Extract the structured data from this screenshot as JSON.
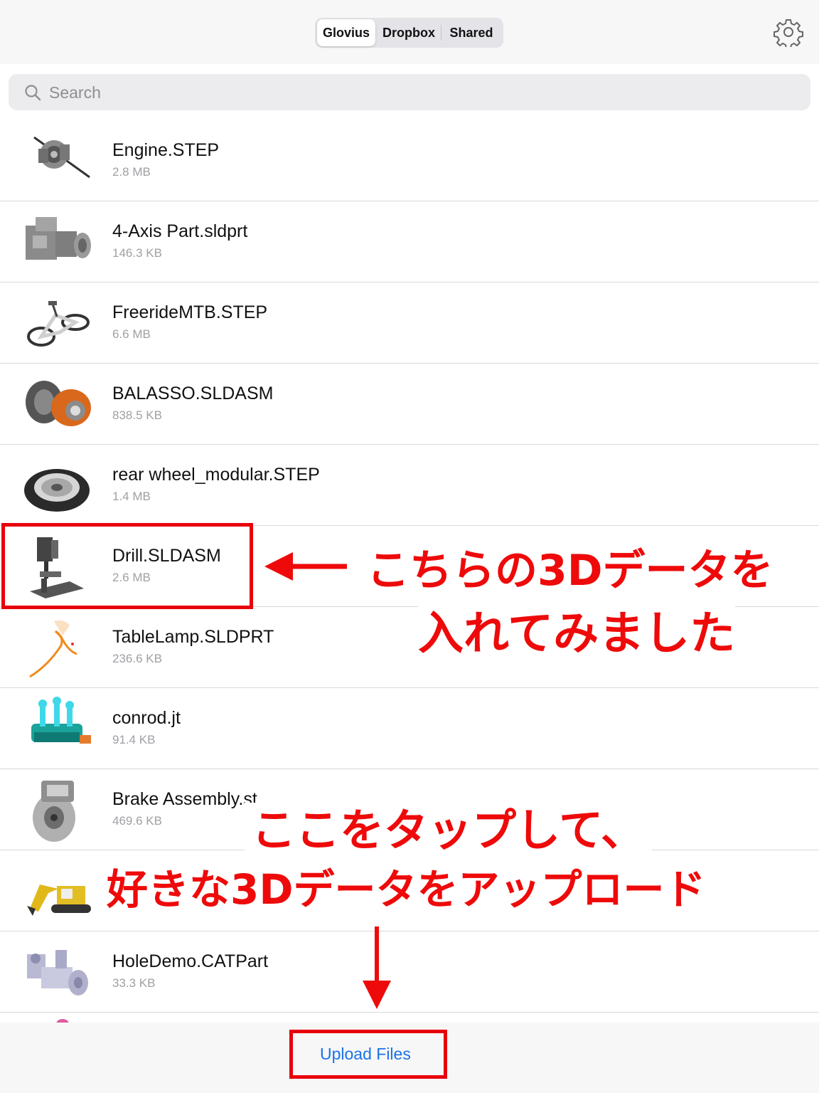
{
  "header": {
    "tabs": [
      {
        "label": "Glovius",
        "active": true
      },
      {
        "label": "Dropbox",
        "active": false
      },
      {
        "label": "Shared",
        "active": false
      }
    ],
    "settings_icon": "gear-icon"
  },
  "search": {
    "placeholder": "Search",
    "icon": "search-icon"
  },
  "files": [
    {
      "name": "Engine.STEP",
      "size": "2.8 MB"
    },
    {
      "name": "4-Axis Part.sldprt",
      "size": "146.3 KB"
    },
    {
      "name": "FreerideMTB.STEP",
      "size": "6.6 MB"
    },
    {
      "name": "BALASSO.SLDASM",
      "size": "838.5 KB"
    },
    {
      "name": "rear wheel_modular.STEP",
      "size": "1.4 MB"
    },
    {
      "name": "Drill.SLDASM",
      "size": "2.6 MB"
    },
    {
      "name": "TableLamp.SLDPRT",
      "size": "236.6 KB"
    },
    {
      "name": "conrod.jt",
      "size": "91.4 KB"
    },
    {
      "name": "Brake Assembly.st",
      "size": "469.6 KB"
    },
    {
      "name": "",
      "size": ""
    },
    {
      "name": "HoleDemo.CATPart",
      "size": "33.3 KB"
    }
  ],
  "footer": {
    "upload_label": "Upload Files"
  },
  "annotations": {
    "drill_line1": "こちらの3Dデータを",
    "drill_line2": "入れてみました",
    "upload_line1": "ここをタップして、",
    "upload_line2": "好きな3Dデータをアップロード",
    "color": "#ee0a0a"
  },
  "colors": {
    "accent": "#1a73e8",
    "highlight": "#e8000c"
  }
}
